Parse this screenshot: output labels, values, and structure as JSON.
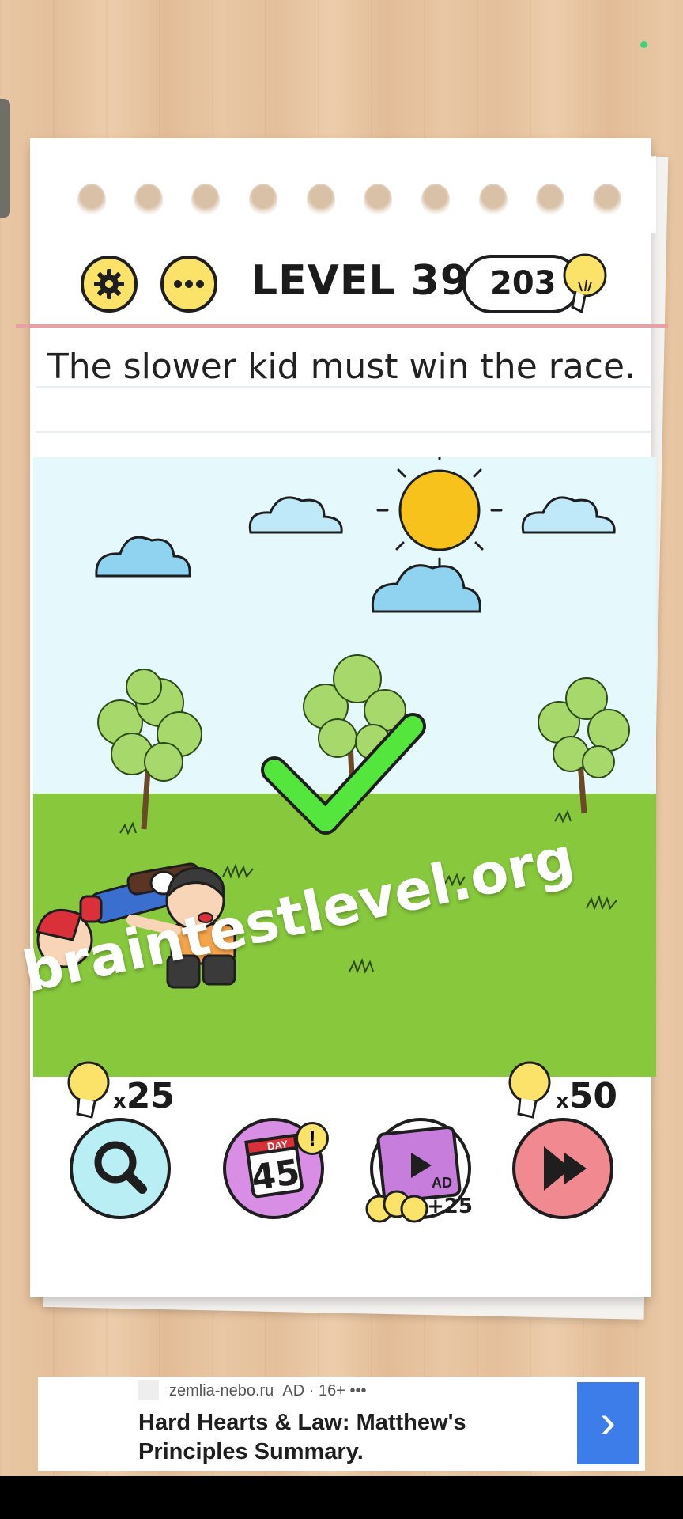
{
  "header": {
    "level_title": "LEVEL 396",
    "hint_count": "203"
  },
  "question": "The slower kid must win the race.",
  "watermark": "braintestlevel.org",
  "tools": {
    "search_cost_prefix": "x",
    "search_cost": "25",
    "calendar_day_label": "DAY",
    "calendar_day": "45",
    "calendar_alert": "!",
    "video_label": "AD",
    "video_reward": "+25",
    "skip_cost_prefix": "x",
    "skip_cost": "50"
  },
  "ad": {
    "domain": "zemlia-nebo.ru",
    "meta": "AD · 16+ •••",
    "title": "Hard Hearts & Law: Matthew's Principles Summary.",
    "button_glyph": "›"
  },
  "colors": {
    "accent_yellow": "#fbe36a",
    "grass": "#87c83d",
    "sky": "#e5f9fc",
    "check_green": "#55e63d",
    "ad_button": "#3d7dea"
  }
}
